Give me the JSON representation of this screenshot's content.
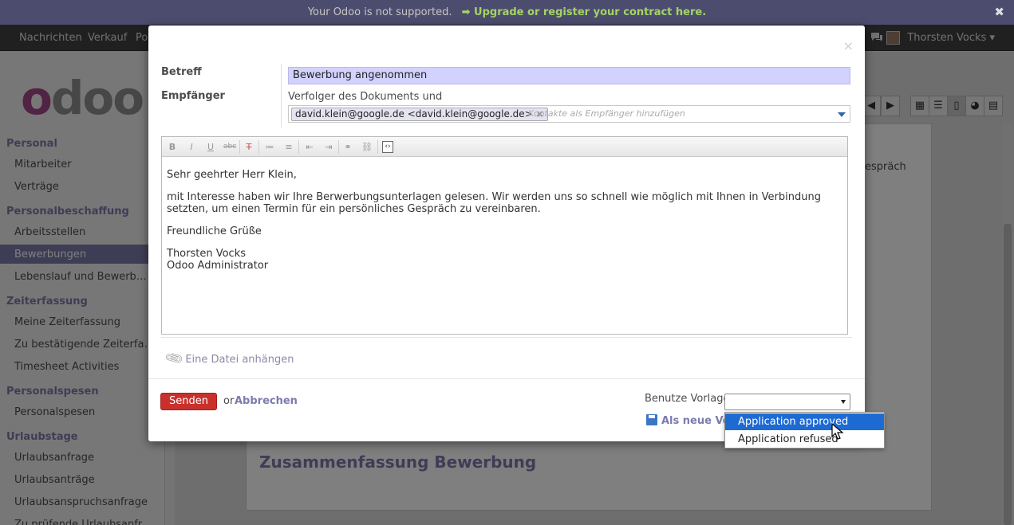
{
  "notice": {
    "message": "Your Odoo is not supported.",
    "upgrade_link": "➡ Upgrade or register your contract here.",
    "close": "✖"
  },
  "topmenu": {
    "items": [
      "Nachrichten",
      "Verkauf",
      "Po"
    ],
    "user_name": "Thorsten Vocks ▾"
  },
  "logo": "odoo",
  "sidebar": {
    "sections": [
      {
        "title": "Personal",
        "items": [
          "Mitarbeiter",
          "Verträge"
        ]
      },
      {
        "title": "Personalbeschaffung",
        "items": [
          "Arbeitsstellen",
          "Bewerbungen",
          "Lebenslauf und Bewerb…"
        ]
      },
      {
        "title": "Zeiterfassung",
        "items": [
          "Meine Zeiterfassung",
          "Zu bestätigende Zeiterfa…",
          "Timesheet Activities"
        ]
      },
      {
        "title": "Personalspesen",
        "items": [
          "Personalspesen"
        ]
      },
      {
        "title": "Urlaubstage",
        "items": [
          "Urlaubsanfrage",
          "Urlaubsanträge",
          "Urlaubsanspruchsanfrage",
          "Zu prüfende Urlaubsanfr…"
        ]
      }
    ],
    "active": "Bewerbungen"
  },
  "background": {
    "side_text": "espräch",
    "heading": "Zusammenfassung Bewerbung"
  },
  "modal": {
    "close": "×",
    "subject_label": "Betreff",
    "subject_value": "Bewerbung angenommen",
    "recipients_label": "Empfänger",
    "followers_text": "Verfolger des Dokuments und",
    "recipient_tag": "david.klein@google.de <david.klein@google.de>",
    "recipient_remove": "×",
    "recipient_placeholder": "Kontakte als Empfänger hinzufügen",
    "toolbar": [
      "B",
      "I",
      "U",
      "abc",
      "T",
      "≔",
      "≡",
      "⇤",
      "⇥",
      "⚭",
      "⛓",
      "‹›"
    ],
    "body": {
      "greeting": "Sehr geehrter Herr Klein,",
      "paragraph": "mit Interesse haben wir Ihre Berwerbungsunterlagen gelesen. Wir werden uns so schnell wie möglich mit Ihnen in Verbindung setzten, um einen Termin für ein persönliches Gespräch zu vereinbaren.",
      "closing": "Freundliche Grüße",
      "signature_name": "Thorsten Vocks",
      "signature_title": "Odoo Administrator"
    },
    "attach_label": "Eine Datei anhängen",
    "send_label": "Senden",
    "or_label": "or",
    "cancel_label": "Abbrechen",
    "template_label": "Benutze Vorlage",
    "template_value": "",
    "save_template_label": "Als neue Vorlage speichern"
  },
  "dropdown": {
    "options": [
      "Application approved",
      "Application refused"
    ],
    "highlighted": "Application approved"
  },
  "colors": {
    "accent": "#7c7bad",
    "send": "#c9302c",
    "selected_option": "#1e6ad3",
    "subject_bg": "#d2d2ff"
  }
}
